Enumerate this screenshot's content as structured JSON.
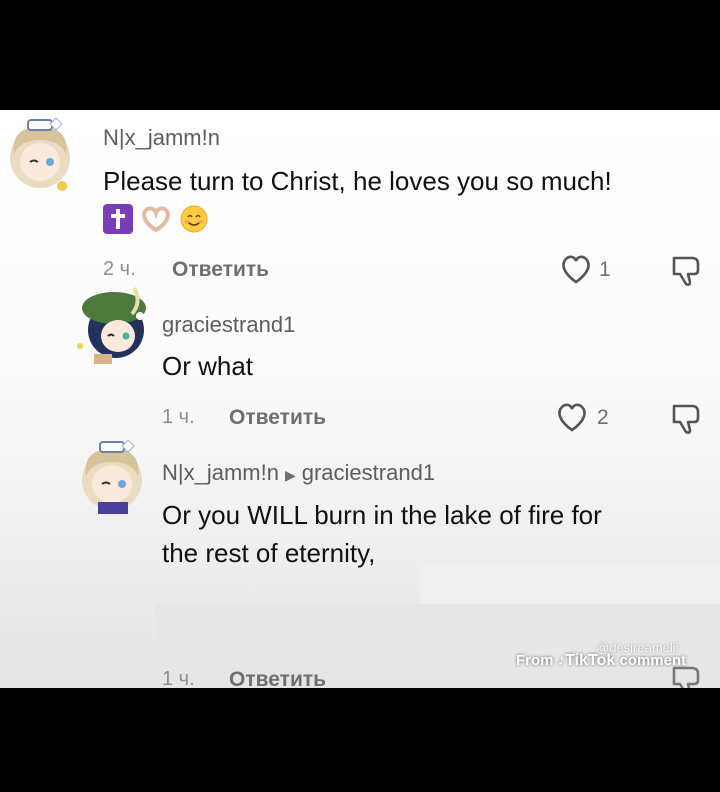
{
  "comments": [
    {
      "username": "N|x_jamm!n",
      "text": "Please turn to Christ, he loves you so much!",
      "emojis": [
        "latin-cross-emoji",
        "heart-hands-emoji",
        "smiling-face-emoji"
      ],
      "time": "2 ч.",
      "reply_label": "Ответить",
      "likes": "1"
    },
    {
      "username": "graciestrand1",
      "text": "Or what",
      "time": "1 ч.",
      "reply_label": "Ответить",
      "likes": "2"
    },
    {
      "username": "N|x_jamm!n",
      "reply_to": "graciestrand1",
      "text_line1": "Or you WILL burn in the lake of fire for",
      "text_line2": "the rest of eternity,",
      "time": "1 ч.",
      "reply_label": "Ответить"
    }
  ],
  "watermark": {
    "from": "From",
    "brand": "TikTok",
    "suffix": "comment",
    "creator": "@desireamelii"
  },
  "colors": {
    "background": "#000000",
    "panel": "#ffffff",
    "username": "#5d5d5d",
    "text": "#111111",
    "meta": "#8e8e8e",
    "emoji_cross": "#7b3db5"
  }
}
